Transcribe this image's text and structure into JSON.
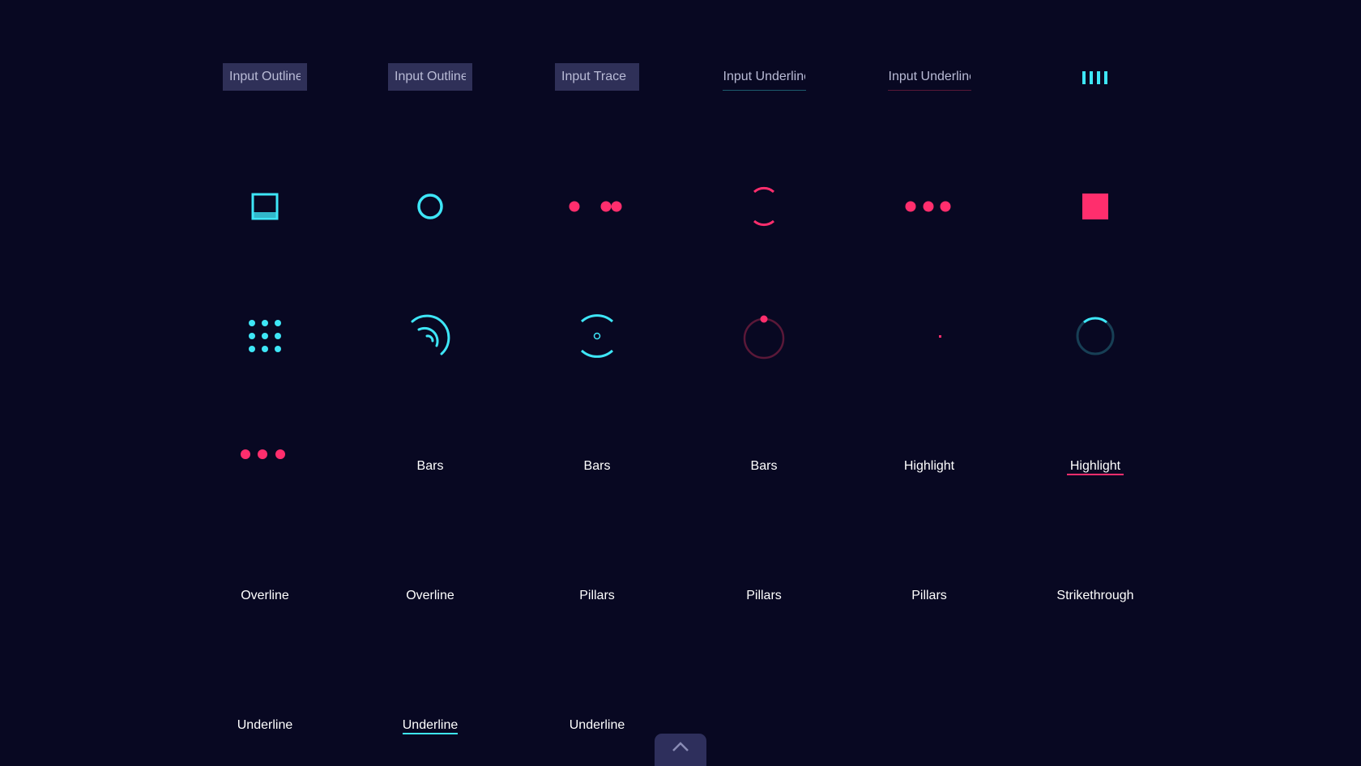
{
  "colors": {
    "background": "#080822",
    "cyan": "#3ee6f7",
    "pink": "#ff2e6d",
    "input_fill": "#2f3058",
    "scroll_button": "#2e2f5c"
  },
  "inputs": [
    {
      "value": "Input Outline",
      "style": "filled"
    },
    {
      "value": "Input Outline",
      "style": "filled"
    },
    {
      "value": "Input Trace",
      "style": "filled"
    },
    {
      "value": "Input Underline",
      "style": "underline-cyan"
    },
    {
      "value": "Input Underline",
      "style": "underline-pink"
    }
  ],
  "loaders": [
    {
      "icon": "bars-loader-icon"
    },
    {
      "icon": "square-fill-loader-icon"
    },
    {
      "icon": "circle-outline-loader-icon"
    },
    {
      "icon": "dots-merge-loader-icon"
    },
    {
      "icon": "arc-brackets-loader-icon"
    },
    {
      "icon": "three-dots-loader-icon"
    },
    {
      "icon": "pink-square-loader-icon"
    },
    {
      "icon": "dot-grid-loader-icon"
    },
    {
      "icon": "radar-arcs-loader-icon"
    },
    {
      "icon": "arc-dot-loader-icon"
    },
    {
      "icon": "orbit-dot-loader-icon"
    },
    {
      "icon": "pulse-dot-loader-icon"
    },
    {
      "icon": "spinner-arc-loader-icon"
    },
    {
      "icon": "three-dots-pink-loader-icon"
    }
  ],
  "labels": {
    "bars_1": "Bars",
    "bars_2": "Bars",
    "bars_3": "Bars",
    "highlight_1": "Highlight",
    "highlight_2": "Highlight",
    "overline_1": "Overline",
    "overline_2": "Overline",
    "pillars_1": "Pillars",
    "pillars_2": "Pillars",
    "pillars_3": "Pillars",
    "strikethrough": "Strikethrough",
    "underline_1": "Underline",
    "underline_2": "Underline",
    "underline_3": "Underline"
  },
  "scroll_top": {
    "icon": "chevron-up-icon"
  }
}
